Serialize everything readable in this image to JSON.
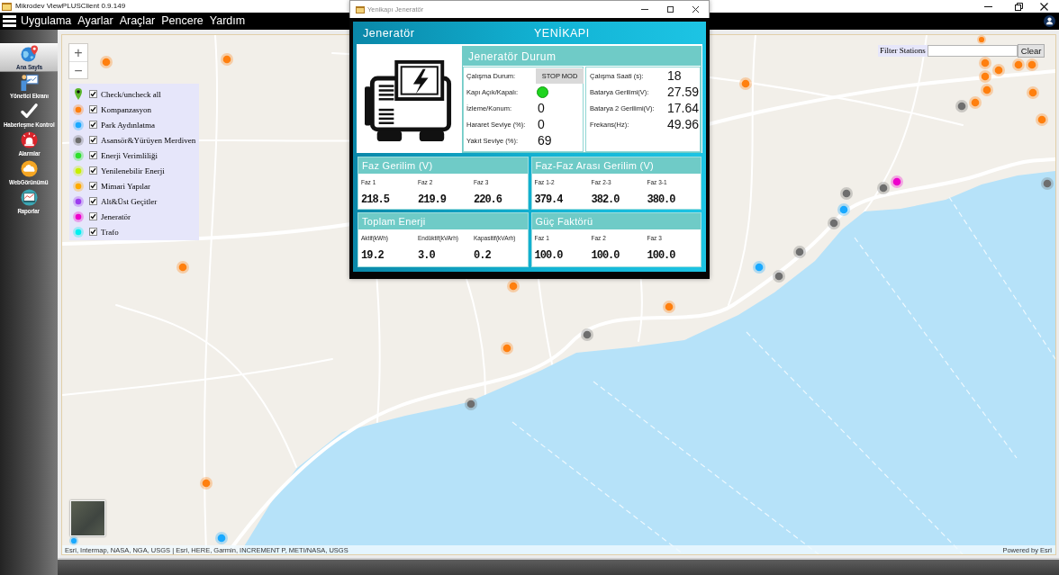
{
  "window": {
    "title": "Mikrodev ViewPLUSClient 0.9.149"
  },
  "menu": {
    "items": [
      "Uygulama",
      "Ayarlar",
      "Araçlar",
      "Pencere",
      "Yardım"
    ]
  },
  "sidebar": {
    "items": [
      {
        "label": "Ana Sayfa",
        "kind": "home",
        "selected": true
      },
      {
        "label": "Yönetici Ekranı",
        "kind": "admin",
        "selected": false
      },
      {
        "label": "Haberleşme Kontrol",
        "kind": "comms",
        "selected": false
      },
      {
        "label": "Alarmlar",
        "kind": "alarms",
        "selected": false
      },
      {
        "label": "WebGörünümü",
        "kind": "web",
        "selected": false
      },
      {
        "label": "Raporlar",
        "kind": "reports",
        "selected": false
      }
    ]
  },
  "map": {
    "zoom_in": "+",
    "zoom_out": "−",
    "layers": [
      {
        "label": "Check/uncheck all",
        "kind": "all",
        "checked": true
      },
      {
        "label": "Kompanzasyon",
        "kind": "layer",
        "color": "#ff7f0e",
        "checked": true
      },
      {
        "label": "Park Aydınlatma",
        "kind": "layer",
        "color": "#1aa9ff",
        "checked": true
      },
      {
        "label": "Asansör&Yürüyen Merdiven",
        "kind": "layer",
        "color": "#6e6e6e",
        "checked": true
      },
      {
        "label": "Enerji Verimliliği",
        "kind": "layer",
        "color": "#2de02d",
        "checked": true
      },
      {
        "label": "Yenilenebilir Enerji",
        "kind": "layer",
        "color": "#c8f000",
        "checked": true
      },
      {
        "label": "Mimari Yapılar",
        "kind": "layer",
        "color": "#ffaa00",
        "checked": true
      },
      {
        "label": "Alt&Üst Geçitler",
        "kind": "layer",
        "color": "#9d3cf0",
        "checked": true
      },
      {
        "label": "Jeneratör",
        "kind": "layer",
        "color": "#ee00cc",
        "checked": true
      },
      {
        "label": "Trafo",
        "kind": "layer",
        "color": "#00f0f0",
        "checked": true
      }
    ],
    "filter": {
      "label": "Filter Stations",
      "button": "Clear"
    },
    "attribution": "Esri, Intermap, NASA, NGA, USGS | Esri, HERE, Garmin, INCREMENT P, METI/NASA, USGS",
    "powered_by": "Powered by Esri"
  },
  "generator_window": {
    "title": "Yenikapı Jeneratör",
    "heading": "Jeneratör",
    "station": "YENİKAPI",
    "status": {
      "title": "Jeneratör Durum",
      "left": [
        {
          "label": "Çalışma Durum:",
          "kind": "mode",
          "value": "STOP MOD"
        },
        {
          "label": "Kapı Açık/Kapalı:",
          "kind": "indicator",
          "on": true
        },
        {
          "label": "İzleme/Konum:",
          "kind": "value",
          "value": "0"
        },
        {
          "label": "Hararet Seviye (%):",
          "kind": "value",
          "value": "0"
        },
        {
          "label": "Yakıt Seviye (%):",
          "kind": "value",
          "value": "69"
        }
      ],
      "right": [
        {
          "label": "Çalışma Saati (s):",
          "value": "18"
        },
        {
          "label": "Batarya Gerilimi(V):",
          "value": "27.59"
        },
        {
          "label": "Batarya 2 Gerilimi(V):",
          "value": "17.64"
        },
        {
          "label": "Frekans(Hz):",
          "value": "49.96"
        }
      ]
    },
    "panels": [
      {
        "title": "Faz Gerilim (V)",
        "cells": [
          {
            "label": "Faz 1",
            "value": "218.5"
          },
          {
            "label": "Faz 2",
            "value": "219.9"
          },
          {
            "label": "Faz 3",
            "value": "220.6"
          }
        ]
      },
      {
        "title": "Faz-Faz Arası Gerilim (V)",
        "cells": [
          {
            "label": "Faz 1-2",
            "value": "379.4"
          },
          {
            "label": "Faz 2-3",
            "value": "382.0"
          },
          {
            "label": "Faz 3-1",
            "value": "380.0"
          }
        ]
      },
      {
        "title": "Toplam Enerji",
        "cells": [
          {
            "label": "Aktif(kWh)",
            "value": "19.2"
          },
          {
            "label": "Endüktif(kVArh)",
            "value": "3.0"
          },
          {
            "label": "Kapasitif(kVArh)",
            "value": "0.2"
          }
        ]
      },
      {
        "title": "Güç Faktörü",
        "cells": [
          {
            "label": "Faz 1",
            "value": "100.0"
          },
          {
            "label": "Faz 2",
            "value": "100.0"
          },
          {
            "label": "Faz 3",
            "value": "100.0"
          }
        ]
      }
    ]
  }
}
